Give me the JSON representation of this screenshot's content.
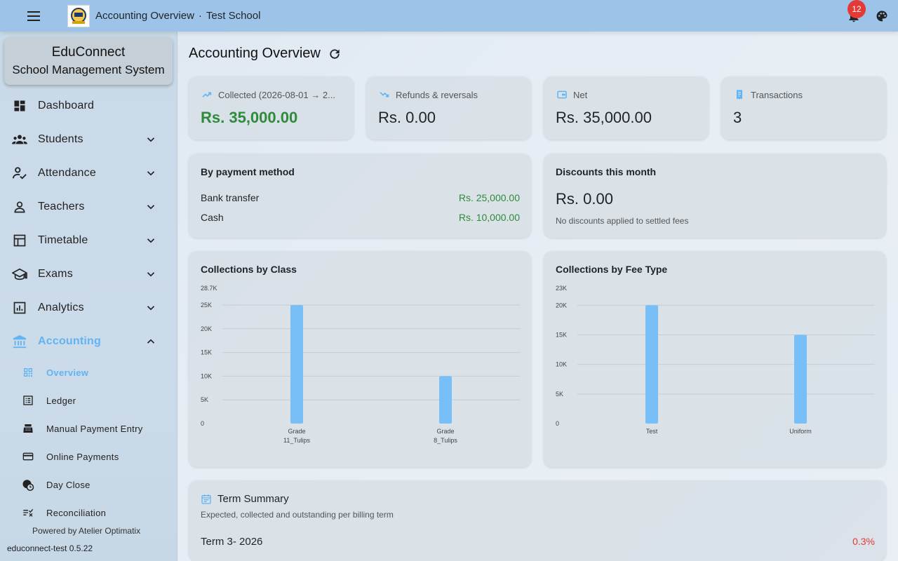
{
  "topbar": {
    "title": "Accounting Overview",
    "separator": "·",
    "school": "Test School",
    "notification_count": "12"
  },
  "sidebar": {
    "brand_name": "EduConnect",
    "brand_sub": "School Management System",
    "items": [
      {
        "label": "Dashboard",
        "icon": "dashboard-icon"
      },
      {
        "label": "Students",
        "icon": "students-icon"
      },
      {
        "label": "Attendance",
        "icon": "attendance-icon"
      },
      {
        "label": "Teachers",
        "icon": "teacher-icon"
      },
      {
        "label": "Timetable",
        "icon": "timetable-icon"
      },
      {
        "label": "Exams",
        "icon": "exams-icon"
      },
      {
        "label": "Analytics",
        "icon": "analytics-icon"
      },
      {
        "label": "Accounting",
        "icon": "bank-icon"
      }
    ],
    "accounting_sub": [
      {
        "label": "Overview",
        "icon": "qr-icon"
      },
      {
        "label": "Ledger",
        "icon": "ledger-icon"
      },
      {
        "label": "Manual Payment Entry",
        "icon": "cash-register-icon"
      },
      {
        "label": "Online Payments",
        "icon": "credit-card-icon"
      },
      {
        "label": "Day Close",
        "icon": "day-close-icon"
      },
      {
        "label": "Reconciliation",
        "icon": "reconciliation-icon"
      }
    ],
    "powered_by": "Powered by Atelier Optimatix",
    "version": "educonnect-test 0.5.22"
  },
  "main": {
    "page_title": "Accounting Overview",
    "stats": [
      {
        "label": "Collected (2026-08-01 → 2...",
        "value": "Rs. 35,000.00",
        "icon": "trending-up-icon"
      },
      {
        "label": "Refunds & reversals",
        "value": "Rs. 0.00",
        "icon": "trending-down-icon"
      },
      {
        "label": "Net",
        "value": "Rs. 35,000.00",
        "icon": "wallet-icon"
      },
      {
        "label": "Transactions",
        "value": "3",
        "icon": "receipt-icon"
      }
    ],
    "payment_method": {
      "title": "By payment method",
      "rows": [
        {
          "method": "Bank transfer",
          "amount": "Rs. 25,000.00"
        },
        {
          "method": "Cash",
          "amount": "Rs. 10,000.00"
        }
      ]
    },
    "discounts": {
      "title": "Discounts this month",
      "value": "Rs. 0.00",
      "note": "No discounts applied to settled fees"
    },
    "term_summary": {
      "title": "Term Summary",
      "subtitle": "Expected, collected and outstanding per billing term",
      "term": "Term 3- 2026",
      "percent": "0.3%"
    }
  },
  "colors": {
    "accent": "#5fb4f4",
    "bar": "#79bff7",
    "positive": "#2e8b3a",
    "negative": "#e53935",
    "topbar": "#9dc3e8"
  },
  "chart_data": [
    {
      "type": "bar",
      "title": "Collections by Class",
      "categories": [
        [
          "Grade",
          "11_Tulips"
        ],
        [
          "Grade",
          "8_Tulips"
        ]
      ],
      "values": [
        25000,
        10000
      ],
      "ylim": [
        0,
        28700
      ],
      "yticks": [
        0,
        5000,
        10000,
        15000,
        20000,
        25000
      ],
      "ytick_labels": [
        "0",
        "5K",
        "10K",
        "15K",
        "20K",
        "25K"
      ],
      "ymax_label": "28.7K",
      "grid": true
    },
    {
      "type": "bar",
      "title": "Collections by Fee Type",
      "categories": [
        [
          "Test"
        ],
        [
          "Uniform"
        ]
      ],
      "values": [
        20000,
        15000
      ],
      "ylim": [
        0,
        23000
      ],
      "yticks": [
        0,
        5000,
        10000,
        15000,
        20000
      ],
      "ytick_labels": [
        "0",
        "5K",
        "10K",
        "15K",
        "20K"
      ],
      "ymax_label": "23K",
      "grid": true
    }
  ]
}
